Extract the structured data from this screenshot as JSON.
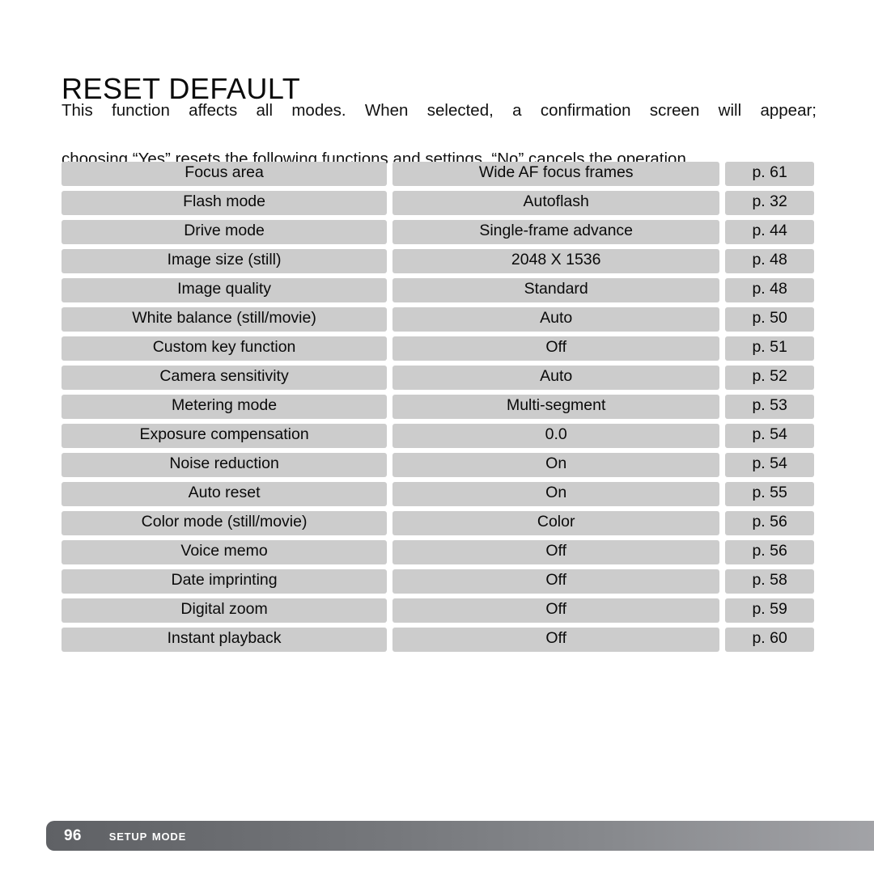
{
  "document": {
    "title": "RESET DEFAULT",
    "intro_line1": "This function affects all modes. When selected, a confirmation screen will appear;",
    "intro_line2": "choosing “Yes” resets the following functions and settings, “No” cancels the operation."
  },
  "table": {
    "rows": [
      {
        "function": "Focus area",
        "setting": "Wide AF focus frames",
        "page": "p. 61"
      },
      {
        "function": "Flash mode",
        "setting": "Autoflash",
        "page": "p. 32"
      },
      {
        "function": "Drive mode",
        "setting": "Single-frame advance",
        "page": "p. 44"
      },
      {
        "function": "Image size (still)",
        "setting": "2048 X 1536",
        "page": "p. 48"
      },
      {
        "function": "Image quality",
        "setting": "Standard",
        "page": "p. 48"
      },
      {
        "function": "White balance (still/movie)",
        "setting": "Auto",
        "page": "p. 50"
      },
      {
        "function": "Custom key function",
        "setting": "Off",
        "page": "p. 51"
      },
      {
        "function": "Camera sensitivity",
        "setting": "Auto",
        "page": "p. 52"
      },
      {
        "function": "Metering mode",
        "setting": "Multi-segment",
        "page": "p. 53"
      },
      {
        "function": "Exposure compensation",
        "setting": "0.0",
        "page": "p. 54"
      },
      {
        "function": "Noise reduction",
        "setting": "On",
        "page": "p. 54"
      },
      {
        "function": "Auto reset",
        "setting": "On",
        "page": "p. 55"
      },
      {
        "function": "Color mode (still/movie)",
        "setting": "Color",
        "page": "p. 56"
      },
      {
        "function": "Voice memo",
        "setting": "Off",
        "page": "p. 56"
      },
      {
        "function": "Date imprinting",
        "setting": "Off",
        "page": "p. 58"
      },
      {
        "function": "Digital zoom",
        "setting": "Off",
        "page": "p. 59"
      },
      {
        "function": "Instant playback",
        "setting": "Off",
        "page": "p. 60"
      }
    ]
  },
  "footer": {
    "page_number": "96",
    "section_label": "Setup mode"
  },
  "colors": {
    "cell_background": "#cccccc",
    "footer_dark": "#5f6165",
    "footer_light": "#a2a3a7",
    "page_background": "#ffffff",
    "text": "#000000"
  }
}
